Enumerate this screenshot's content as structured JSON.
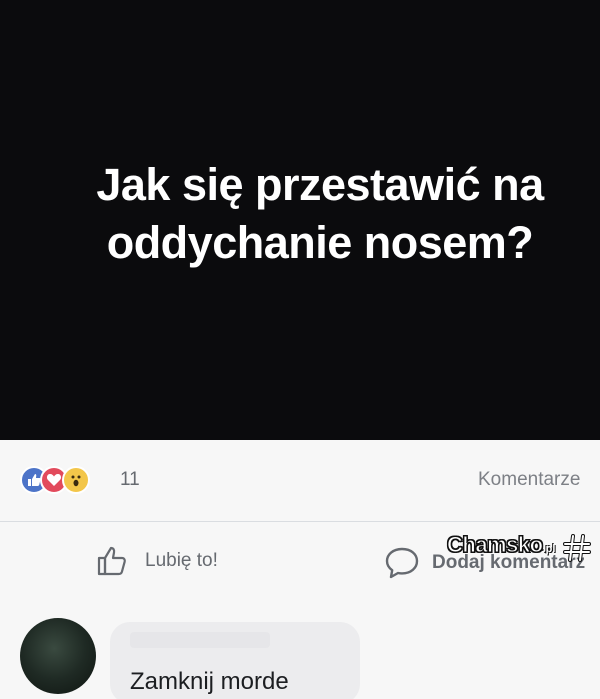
{
  "post": {
    "text_line1": "Jak się przestawić na",
    "text_line2": "oddychanie nosem?"
  },
  "reactions": {
    "icons": [
      "like-icon",
      "love-icon",
      "wow-icon"
    ],
    "count": "11",
    "comments_label": "Komentarze"
  },
  "actions": {
    "like_label": "Lubię to!",
    "comment_label": "Dodaj komentarz"
  },
  "watermark": {
    "name": "Chamsko",
    "suffix": ".pl"
  },
  "comment": {
    "text": "Zamknij morde"
  },
  "colors": {
    "image_bg": "#0b0b0d",
    "like_blue": "#4d74c8",
    "love_red": "#e24a5c",
    "wow_yellow": "#f3c64a"
  }
}
